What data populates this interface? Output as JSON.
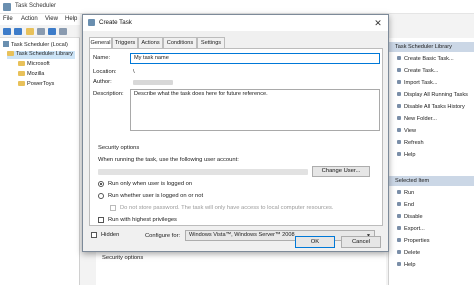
{
  "app": {
    "title": "Task Scheduler",
    "menu": [
      "File",
      "Action",
      "View",
      "Help"
    ]
  },
  "tree": {
    "root": "Task Scheduler (Local)",
    "library": "Task Scheduler Library",
    "folders": [
      "Microsoft",
      "Mozilla",
      "PowerToys"
    ]
  },
  "actions": {
    "header_library": "Task Scheduler Library",
    "library_items": [
      {
        "label": "Create Basic Task...",
        "icon": "wand-icon"
      },
      {
        "label": "Create Task...",
        "icon": "task-icon"
      },
      {
        "label": "Import Task...",
        "icon": "import-icon"
      },
      {
        "label": "Display All Running Tasks",
        "icon": "running-tasks-icon"
      },
      {
        "label": "Disable All Tasks History",
        "icon": "history-icon"
      },
      {
        "label": "New Folder...",
        "icon": "folder-icon"
      },
      {
        "label": "View",
        "icon": "view-icon"
      },
      {
        "label": "Refresh",
        "icon": "refresh-icon"
      },
      {
        "label": "Help",
        "icon": "help-icon"
      }
    ],
    "header_selected": "Selected Item",
    "selected_items": [
      {
        "label": "Run",
        "icon": "run-icon"
      },
      {
        "label": "End",
        "icon": "end-icon"
      },
      {
        "label": "Disable",
        "icon": "disable-icon"
      },
      {
        "label": "Export...",
        "icon": "export-icon"
      },
      {
        "label": "Properties",
        "icon": "properties-icon"
      },
      {
        "label": "Delete",
        "icon": "delete-icon"
      },
      {
        "label": "Help",
        "icon": "help-icon"
      }
    ]
  },
  "bottom_panel": {
    "security_options_label": "Security options"
  },
  "dialog": {
    "title": "Create Task",
    "close_glyph": "✕",
    "tabs": [
      "General",
      "Triggers",
      "Actions",
      "Conditions",
      "Settings"
    ],
    "active_tab": "General",
    "name_label": "Name:",
    "name_value": "My task name",
    "location_label": "Location:",
    "location_value": "\\",
    "author_label": "Author:",
    "description_label": "Description:",
    "description_value": "Describe what the task does here for future reference.",
    "security_header": "Security options",
    "run_as_prompt": "When running the task, use the following user account:",
    "change_user_button": "Change User...",
    "radio_logged_on": "Run only when user is logged on",
    "radio_whether": "Run whether user is logged on or not",
    "no_store_password": "Do not store password.  The task will only have access to local computer resources.",
    "highest_privileges": "Run with highest privileges",
    "hidden_label": "Hidden",
    "configure_for_label": "Configure for:",
    "configure_for_value": "Windows Vista™, Windows Server™ 2008",
    "ok_button": "OK",
    "cancel_button": "Cancel"
  },
  "colors": {
    "accent_header": "#cbd7e6",
    "focus_border": "#0078d7",
    "folder": "#e8c15a"
  }
}
